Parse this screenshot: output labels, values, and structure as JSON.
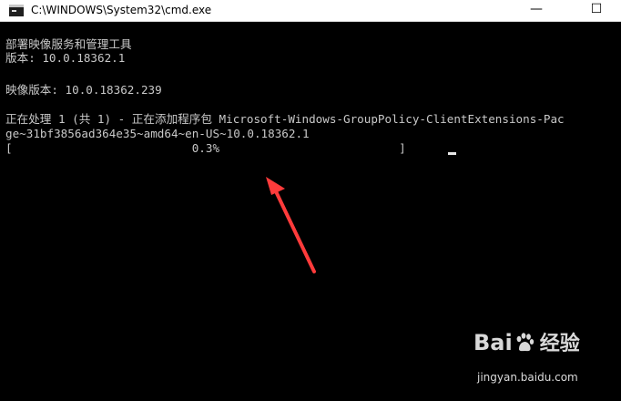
{
  "window": {
    "title": "C:\\WINDOWS\\System32\\cmd.exe",
    "minimize_glyph": "—",
    "maximize_glyph": "☐",
    "app_icon": "cmd-icon"
  },
  "console": {
    "lines": [
      "部署映像服务和管理工具",
      "版本: 10.0.18362.1",
      "",
      "映像版本: 10.0.18362.239",
      "",
      "正在处理 1 (共 1) - 正在添加程序包 Microsoft-Windows-GroupPolicy-ClientExtensions-Package~31bf3856ad364e35~amd64~en-US~10.0.18362.1",
      "[                          0.3%                          ]"
    ],
    "line_wrap_1": "正在处理 1 (共 1) - 正在添加程序包 Microsoft-Windows-GroupPolicy-ClientExtensions-Pac",
    "line_wrap_2": "ge~31bf3856ad364e35~amd64~en-US~10.0.18362.1",
    "progress_text": "[                          0.3%                          ]",
    "progress_percent": 0.3
  },
  "annotation": {
    "color": "#ff3b3b",
    "icon": "red-arrow-icon"
  },
  "watermark": {
    "logo_prefix": "Bai",
    "logo_suffix": "经验",
    "url": "jingyan.baidu.com"
  },
  "colors": {
    "console_bg": "#000000",
    "console_text": "#c8c8c8",
    "titlebar_bg": "#ffffff",
    "accent_edge": "#1e5aa0"
  }
}
